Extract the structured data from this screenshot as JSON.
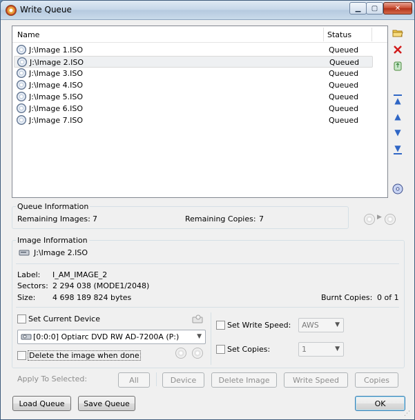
{
  "window": {
    "title": "Write Queue",
    "minimize": "▁",
    "maximize": "▢",
    "close": "✕"
  },
  "queue_list": {
    "columns": [
      "Name",
      "Status"
    ],
    "rows": [
      {
        "name": "J:\\Image 1.ISO",
        "status": "Queued"
      },
      {
        "name": "J:\\Image 2.ISO",
        "status": "Queued"
      },
      {
        "name": "J:\\Image 3.ISO",
        "status": "Queued"
      },
      {
        "name": "J:\\Image 4.ISO",
        "status": "Queued"
      },
      {
        "name": "J:\\Image 5.ISO",
        "status": "Queued"
      },
      {
        "name": "J:\\Image 6.ISO",
        "status": "Queued"
      },
      {
        "name": "J:\\Image 7.ISO",
        "status": "Queued"
      }
    ]
  },
  "side_toolbar": {
    "icons": [
      "open-folder-icon",
      "delete-icon",
      "recycle-icon",
      "move-top-icon",
      "move-up-icon",
      "move-down-icon",
      "move-bottom-icon",
      "disc-icon"
    ]
  },
  "queue_info": {
    "title": "Queue Information",
    "remaining_images_label": "Remaining Images:",
    "remaining_images_value": "7",
    "remaining_copies_label": "Remaining Copies:",
    "remaining_copies_value": "7"
  },
  "image_info": {
    "title": "Image Information",
    "file": "J:\\Image 2.ISO",
    "label_label": "Label:",
    "label_value": "I_AM_IMAGE_2",
    "sectors_label": "Sectors:",
    "sectors_value": "2 294 038 (MODE1/2048)",
    "size_label": "Size:",
    "size_value": "4 698 189 824 bytes",
    "burnt_label": "Burnt Copies:",
    "burnt_value": "0 of 1"
  },
  "options": {
    "set_current_device": "Set Current Device",
    "device": "[0:0:0] Optiarc DVD RW AD-7200A (P:)",
    "delete_when_done": "Delete the image when done",
    "set_write_speed": "Set Write Speed:",
    "write_speed": "AWS",
    "set_copies": "Set Copies:",
    "copies": "1"
  },
  "apply": {
    "label": "Apply To Selected:",
    "all": "All",
    "device": "Device",
    "delete_image": "Delete Image",
    "write_speed": "Write Speed",
    "copies": "Copies"
  },
  "footer": {
    "load_queue": "Load Queue",
    "save_queue": "Save Queue",
    "ok": "OK"
  }
}
